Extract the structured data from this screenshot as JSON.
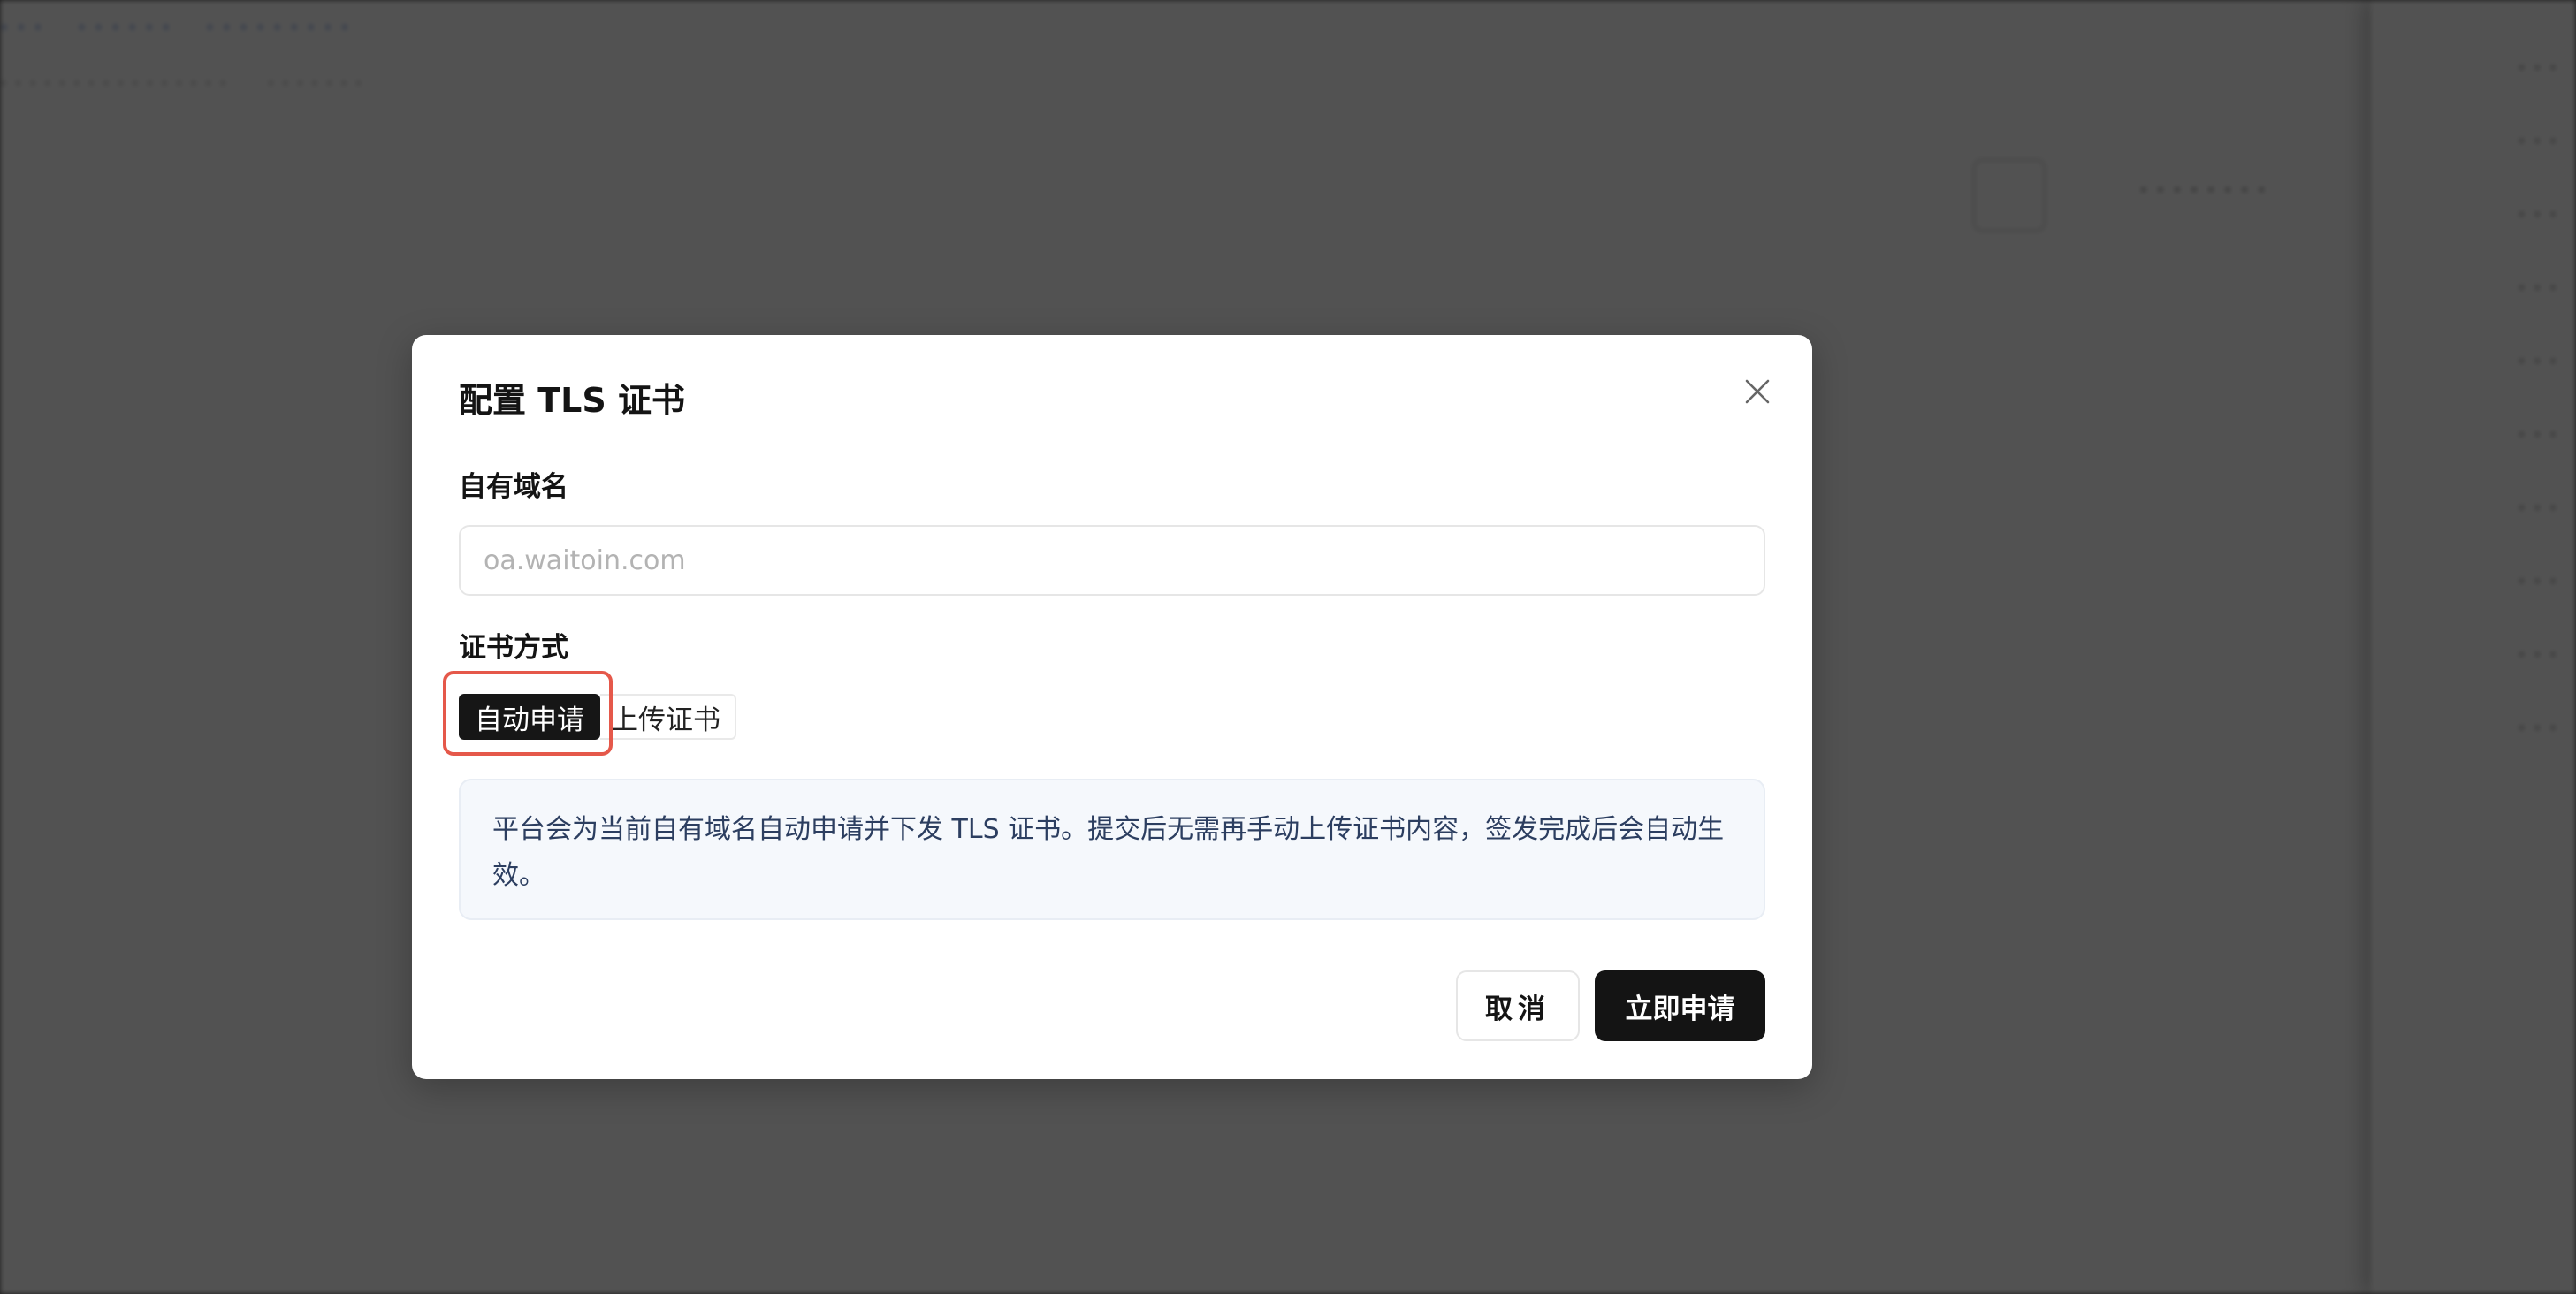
{
  "modal": {
    "title": "配置 TLS 证书",
    "domain_field": {
      "label": "自有域名",
      "value": "",
      "placeholder": "oa.waitoin.com"
    },
    "method_field": {
      "label": "证书方式",
      "options": [
        "自动申请",
        "上传证书"
      ],
      "selected": "自动申请"
    },
    "info_text": "平台会为当前自有域名自动申请并下发 TLS 证书。提交后无需再手动上传证书内容，签发完成后会自动生效。",
    "cancel_label": "取消",
    "submit_label": "立即申请",
    "highlight_color": "#e5584a",
    "accent_color": "#141414"
  }
}
